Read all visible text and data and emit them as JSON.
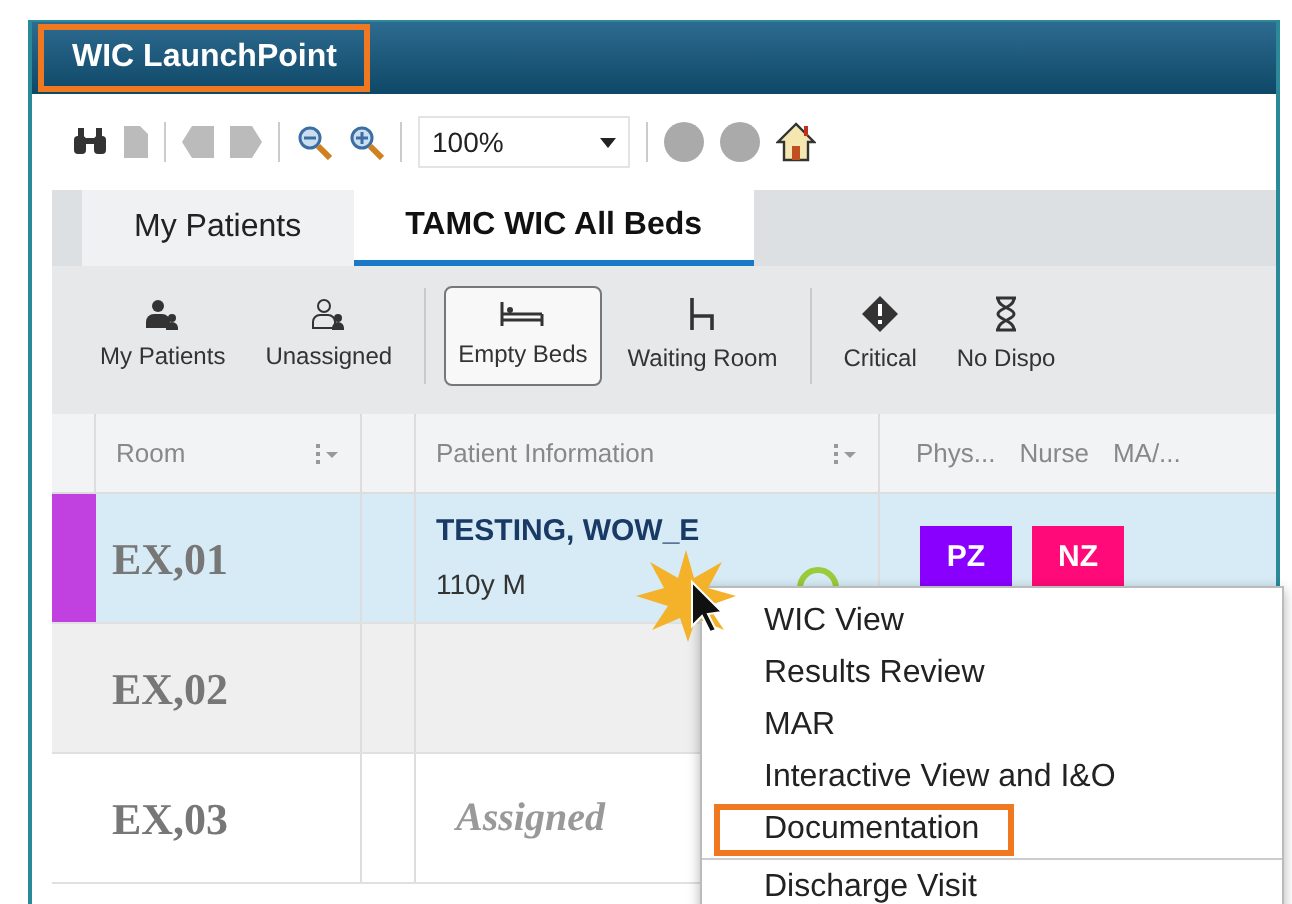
{
  "window": {
    "title": "WIC LaunchPoint",
    "title_highlighted": true
  },
  "toolbar": {
    "zoom": "100%"
  },
  "tabs": [
    {
      "label": "My Patients",
      "selected": false
    },
    {
      "label": "TAMC WIC All Beds",
      "selected": true
    }
  ],
  "filters": [
    {
      "label": "My Patients",
      "kind": "person",
      "selected": false
    },
    {
      "label": "Unassigned",
      "kind": "person-outline",
      "selected": false
    },
    {
      "label": "Empty Beds",
      "kind": "bed",
      "selected": true
    },
    {
      "label": "Waiting Room",
      "kind": "chair",
      "selected": false
    },
    {
      "label": "Critical",
      "kind": "alert",
      "selected": false
    },
    {
      "label": "No Dispo",
      "kind": "hourglass",
      "selected": false
    }
  ],
  "table": {
    "columns": [
      "Room",
      "Patient Information",
      "Phys...",
      "Nurse",
      "MA/..."
    ],
    "rows": [
      {
        "room": "EX,01",
        "selected": true,
        "color": "#c040e0",
        "patient": "TESTING, WOW_E",
        "detail": "110y M",
        "badges": [
          {
            "text": "PZ",
            "color": "#8a00ff"
          },
          {
            "text": "NZ",
            "color": "#ff0a78"
          }
        ]
      },
      {
        "room": "EX,02",
        "selected": false
      },
      {
        "room": "EX,03",
        "selected": false,
        "status": "Assigned"
      }
    ]
  },
  "context_menu": {
    "items": [
      {
        "label": "WIC View",
        "highlighted": false
      },
      {
        "label": "Results Review",
        "highlighted": false
      },
      {
        "label": "MAR",
        "highlighted": false
      },
      {
        "label": "Interactive View and I&O",
        "highlighted": false
      },
      {
        "label": "Documentation",
        "highlighted": true
      },
      {
        "label": "Discharge Visit",
        "highlighted": false
      }
    ]
  }
}
